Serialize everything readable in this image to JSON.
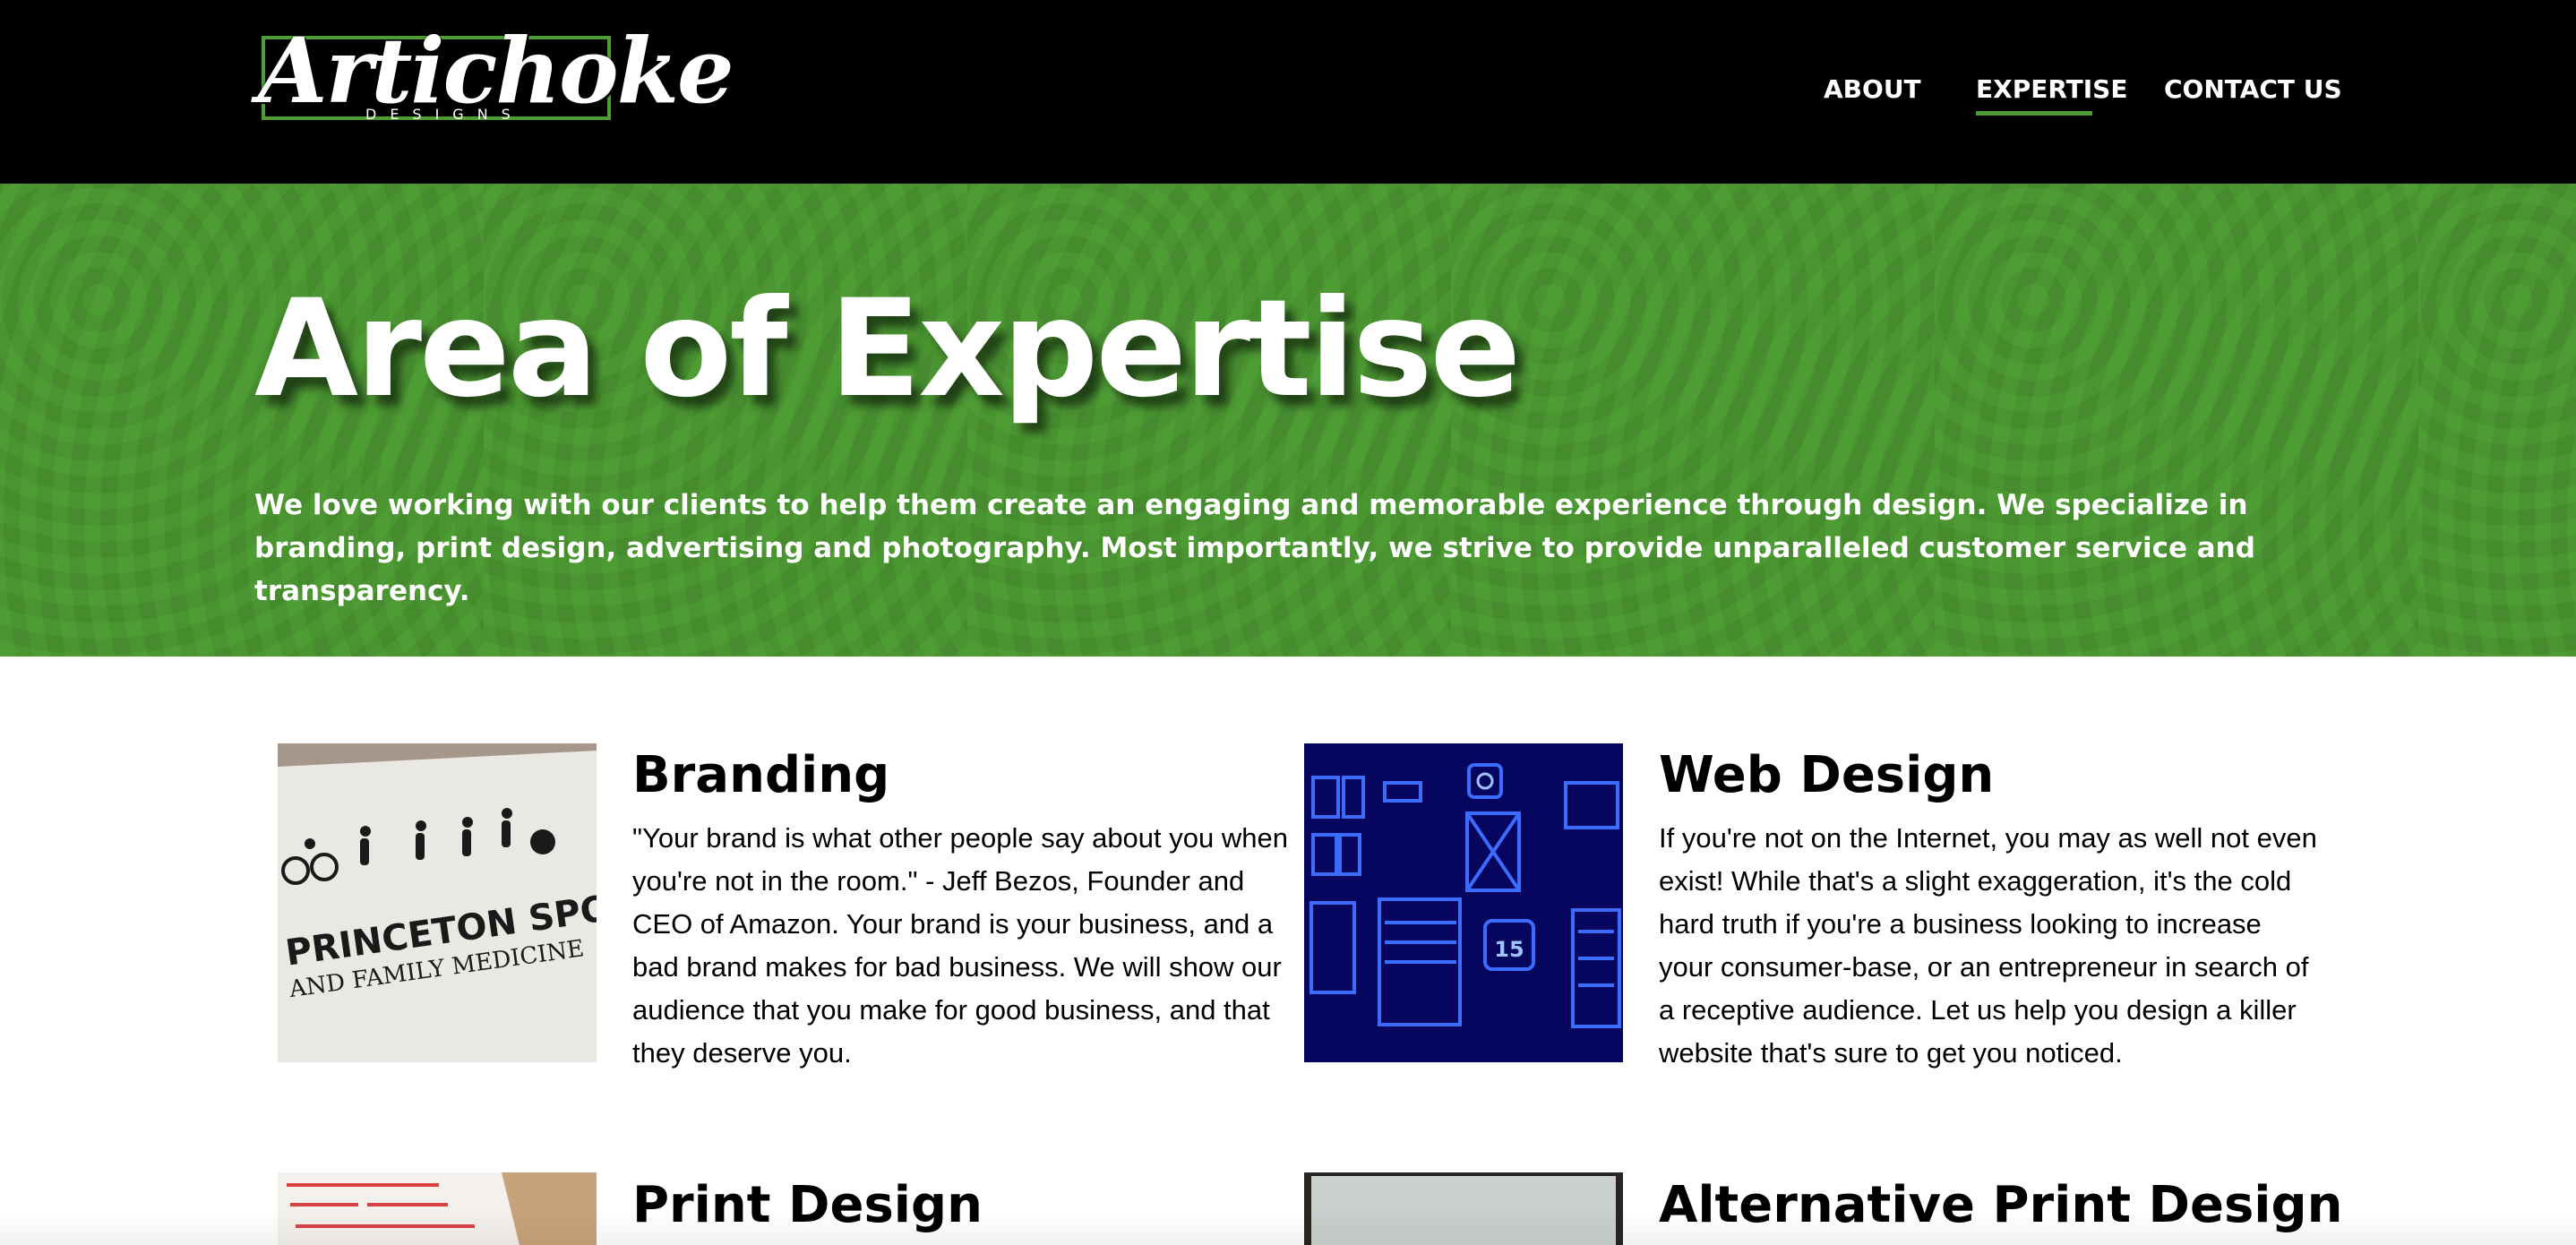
{
  "header": {
    "logo": {
      "script": "Artichoke",
      "subtitle": "DESIGNS"
    },
    "nav": [
      {
        "label": "ABOUT"
      },
      {
        "label": "EXPERTISE",
        "active": true
      },
      {
        "label": "CONTACT US"
      }
    ]
  },
  "hero": {
    "title": "Area of Expertise",
    "intro": "We love working with our clients to help them create an engaging and memorable experience through design. We specialize in branding, print design, advertising and photography. Most importantly, we strive to provide unparalleled customer service and transparency."
  },
  "services": [
    {
      "title": "Branding",
      "text": "\"Your brand is what other people say about you when you're not in the room.\" - Jeff Bezos, Founder and CEO of Amazon. Your brand is your business, and a bad brand makes for bad business. We will show our audience that you make for good business, and that they deserve you.",
      "image": {
        "line1": "PRINCETON SPORTS",
        "line2": "AND FAMILY MEDICINE"
      }
    },
    {
      "title": "Web Design",
      "text": "If you're not on the Internet, you may as well not even exist! While that's a slight exaggeration, it's the cold hard truth if you're a business looking to increase your consumer-base, or an entrepreneur in search of a receptive audience. Let us help you design a killer website that's sure to get you noticed.",
      "image": {
        "calendar_number": "15"
      }
    },
    {
      "title": "Print Design"
    },
    {
      "title": "Alternative Print Design"
    }
  ],
  "colors": {
    "header_bg": "#000000",
    "accent_green": "#4e9c34",
    "text": "#000000",
    "hero_text": "#ffffff"
  }
}
